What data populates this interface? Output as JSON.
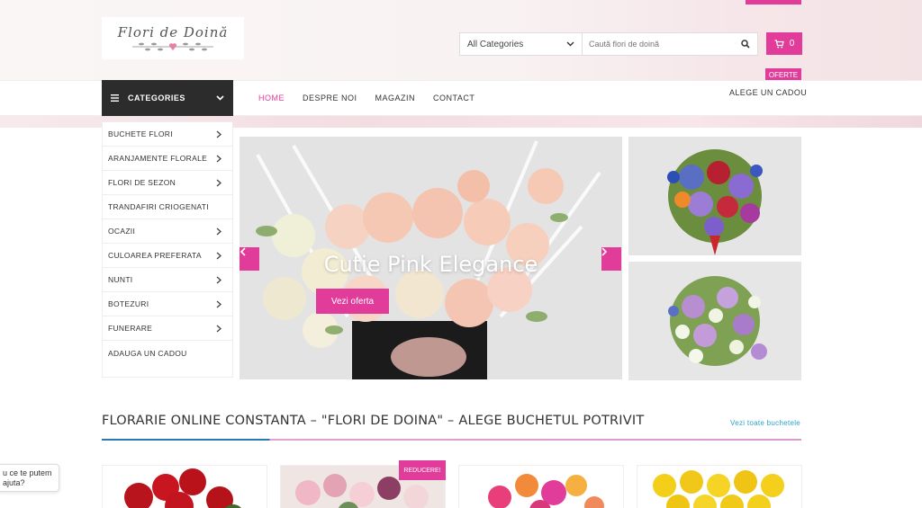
{
  "header": {
    "logo_text": "Flori de Doină",
    "search": {
      "category_selected": "All Categories",
      "placeholder": "Caută flori de doină"
    },
    "cart_count": "0",
    "oferte_label": "OFERTE"
  },
  "nav": {
    "categories_label": "CATEGORIES",
    "links": [
      "HOME",
      "DESPRE NOI",
      "MAGAZIN",
      "CONTACT"
    ],
    "right_link": "ALEGE UN CADOU"
  },
  "sidebar": {
    "items": [
      {
        "label": "BUCHETE FLORI",
        "has_arrow": true
      },
      {
        "label": "ARANJAMENTE FLORALE",
        "has_arrow": true
      },
      {
        "label": "FLORI DE SEZON",
        "has_arrow": true
      },
      {
        "label": "TRANDAFIRI CRIOGENATI",
        "has_arrow": false
      },
      {
        "label": "OCAZII",
        "has_arrow": true
      },
      {
        "label": "CULOAREA PREFERATA",
        "has_arrow": true
      },
      {
        "label": "NUNTI",
        "has_arrow": true
      },
      {
        "label": "BOTEZURI",
        "has_arrow": true
      },
      {
        "label": "FUNERARE",
        "has_arrow": true
      },
      {
        "label": "ADAUGA UN CADOU",
        "has_arrow": false
      }
    ]
  },
  "hero": {
    "title": "Cutie Pink Elegance",
    "button_label": "Vezi oferta"
  },
  "section": {
    "title": "FLORARIE ONLINE CONSTANTA – \"FLORI DE DOINA\" – ALEGE BUCHETUL POTRIVIT",
    "link_label": "Vezi toate buchetele",
    "discount_badge": "REDUCERE!"
  },
  "chat": {
    "text": "u ce te putem ajuta?"
  },
  "colors": {
    "accent": "#e23c9b",
    "dark": "#2c2c2c",
    "link": "#2aa3c5"
  }
}
